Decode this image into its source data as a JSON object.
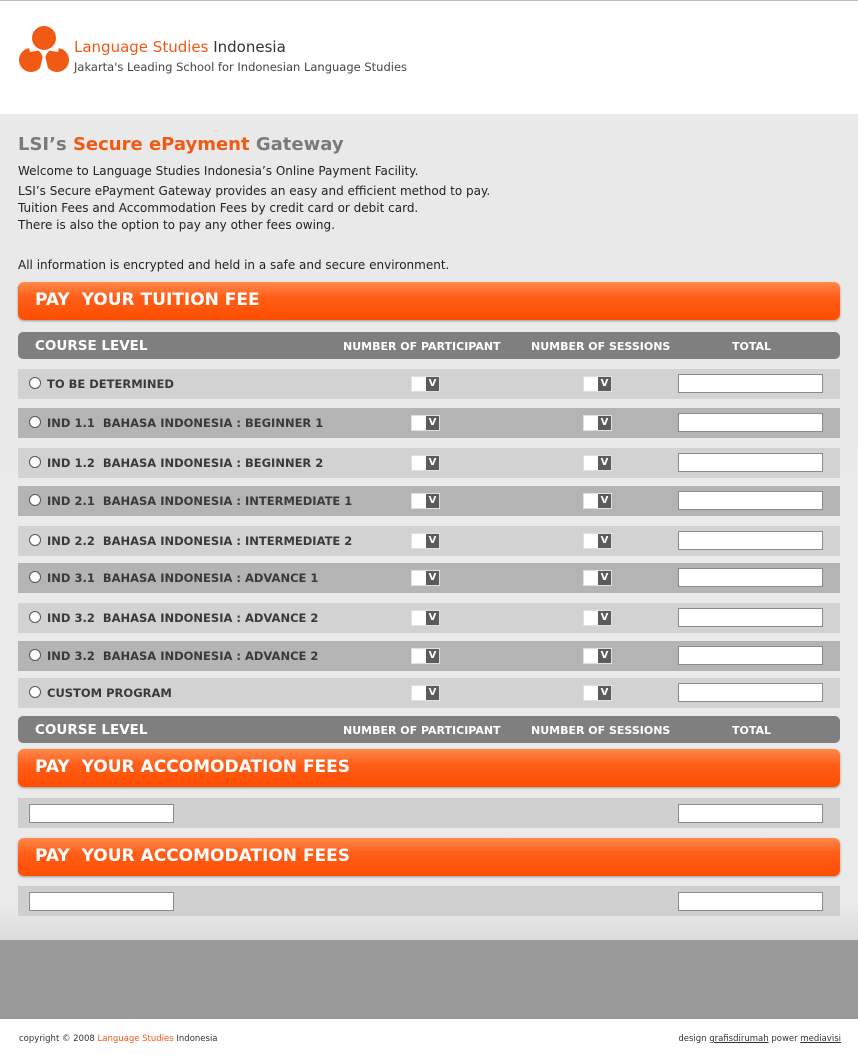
{
  "header": {
    "brand": "Language Studies",
    "brand_rest": "Indonesia",
    "tagline": "Jakarta's Leading School for Indonesian Language Studies",
    "colors": {
      "accent": "#f05a14"
    },
    "logo_icon": "three-petal-logo-icon"
  },
  "intro": {
    "heading_prefix": "LSI’s",
    "heading_accent": "Secure ePayment",
    "heading_suffix": "Gateway",
    "line1": "Welcome to Language Studies Indonesia’s Online Payment Facility.",
    "line2": "LSI’s Secure ePayment Gateway provides an easy and efficient method to pay.",
    "line3": "Tuition Fees and Accommodation Fees by credit card or debit card.",
    "line4": "There is also the option to pay any other fees owing.",
    "line5": "All information is encrypted and held in a safe and secure environment."
  },
  "tuition": {
    "section_title": "PAY  YOUR TUITION FEE",
    "headers": {
      "course_level": "COURSE LEVEL",
      "participants": "NUMBER OF PARTICIPANT",
      "sessions": "NUMBER OF SESSIONS",
      "total": "TOTAL"
    },
    "select_arrow": "V",
    "courses": [
      {
        "label": "TO BE DETERMINED"
      },
      {
        "label": "IND 1.1  BAHASA INDONESIA : BEGINNER 1"
      },
      {
        "label": "IND 1.2  BAHASA INDONESIA : BEGINNER 2"
      },
      {
        "label": "IND 2.1  BAHASA INDONESIA : INTERMEDIATE 1"
      },
      {
        "label": "IND 2.2  BAHASA INDONESIA : INTERMEDIATE 2"
      },
      {
        "label": "IND 3.1  BAHASA INDONESIA : ADVANCE 1"
      },
      {
        "label": "IND 3.2  BAHASA INDONESIA : ADVANCE 2"
      },
      {
        "label": "IND 3.2  BAHASA INDONESIA : ADVANCE 2"
      },
      {
        "label": "CUSTOM PROGRAM"
      }
    ]
  },
  "accommodation": {
    "section_title": "PAY  YOUR ACCOMODATION FEES"
  },
  "accommodation2": {
    "section_title": "PAY  YOUR ACCOMODATION FEES"
  },
  "footer": {
    "copyright": "copyright © 2008",
    "brand": "Language Studies",
    "brand_rest": "Indonesia",
    "design_label": "design",
    "design_link": "grafisdirumah",
    "power_label": "power",
    "power_link": "mediavisi"
  }
}
